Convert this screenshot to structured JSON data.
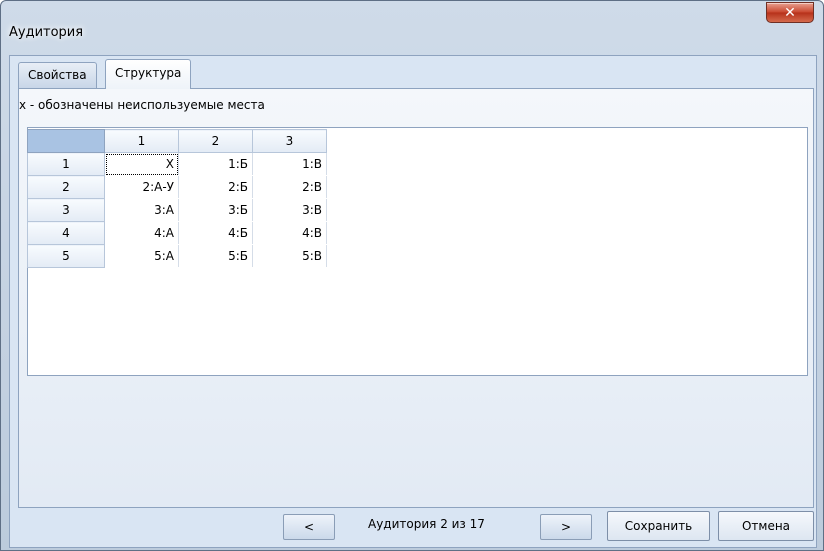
{
  "window": {
    "title": "Аудитория",
    "close_icon": "✕"
  },
  "tabs": [
    {
      "label": "Свойства",
      "active": false
    },
    {
      "label": "Структура",
      "active": true
    }
  ],
  "hint": "x - обозначены неиспользуемые места",
  "grid": {
    "columns": [
      "1",
      "2",
      "3"
    ],
    "rows": [
      {
        "label": "1",
        "cells": [
          "X",
          "1:Б",
          "1:В"
        ]
      },
      {
        "label": "2",
        "cells": [
          "2:А-У",
          "2:Б",
          "2:В"
        ]
      },
      {
        "label": "3",
        "cells": [
          "3:А",
          "3:Б",
          "3:В"
        ]
      },
      {
        "label": "4",
        "cells": [
          "4:А",
          "4:Б",
          "4:В"
        ]
      },
      {
        "label": "5",
        "cells": [
          "5:А",
          "5:Б",
          "5:В"
        ]
      }
    ]
  },
  "footer": {
    "prev_label": "<",
    "counter": "Аудитория 2 из 17",
    "next_label": ">",
    "save_label": "Сохранить",
    "cancel_label": "Отмена"
  }
}
